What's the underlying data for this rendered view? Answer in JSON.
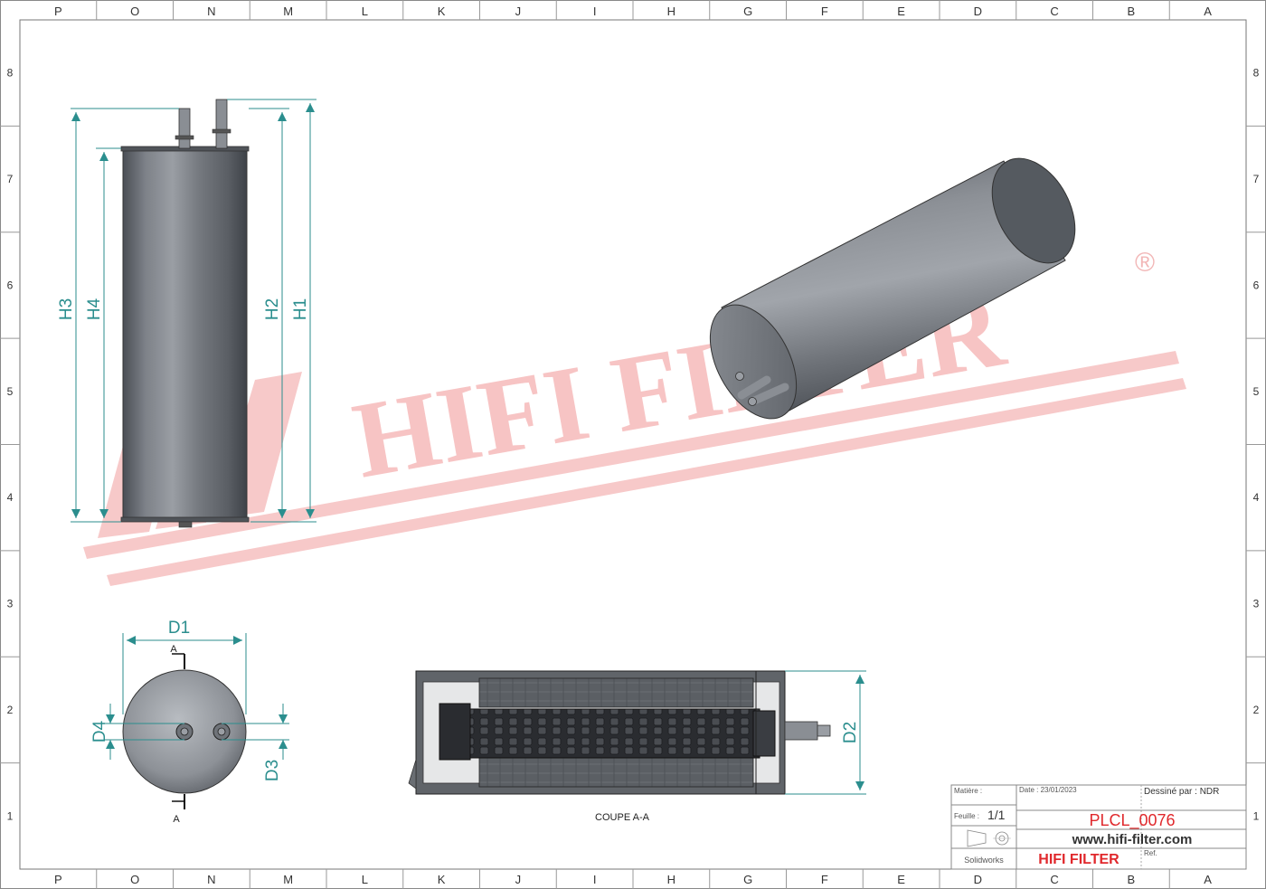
{
  "grid": {
    "columns": [
      "P",
      "O",
      "N",
      "M",
      "L",
      "K",
      "J",
      "I",
      "H",
      "G",
      "F",
      "E",
      "D",
      "C",
      "B",
      "A"
    ],
    "rows": [
      "8",
      "7",
      "6",
      "5",
      "4",
      "3",
      "2",
      "1"
    ]
  },
  "dimensions": {
    "h1": "H1",
    "h2": "H2",
    "h3": "H3",
    "h4": "H4",
    "d1": "D1",
    "d2": "D2",
    "d3": "D3",
    "d4": "D4",
    "section_marker": "A"
  },
  "section_title": "COUPE A-A",
  "watermark": {
    "brand": "HIFI FILTER",
    "registered": "®"
  },
  "title_block": {
    "matiere_label": "Matière :",
    "date": "Date : 23/01/2023",
    "drawn_by": "Dessiné par : NDR",
    "sheet_label": "Feuille :",
    "sheet_value": "1/1",
    "part_number": "PLCL_0076",
    "website": "www.hifi-filter.com",
    "software": "Solidworks",
    "brand": "HIFI FILTER",
    "ref_label": "Ref."
  },
  "colors": {
    "dimension": "#2b8e8e",
    "watermark": "#f7c4c4",
    "brand": "#e0282c",
    "body_metal": "#6e7278"
  }
}
